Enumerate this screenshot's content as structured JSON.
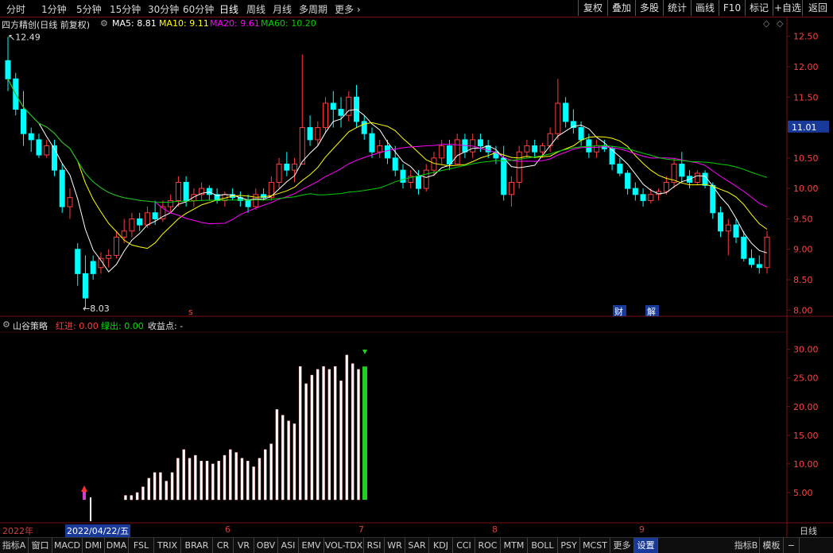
{
  "toolbar": {
    "timeframes": [
      "分时",
      "1分钟",
      "5分钟",
      "15分钟",
      "30分钟",
      "60分钟",
      "日线",
      "周线",
      "月线",
      "多周期",
      "更多"
    ],
    "active_timeframe": "日线",
    "right_buttons": [
      "复权",
      "叠加",
      "多股",
      "统计",
      "画线",
      "F10",
      "标记",
      "+自选",
      "返回"
    ]
  },
  "chart_header": {
    "stock_title": "四方精创(日线 前复权)",
    "ma5": "MA5: 8.81",
    "ma10": "MA10: 9.11",
    "ma20": "MA20: 9.61",
    "ma60": "MA60: 10.20",
    "high_label": "12.49",
    "low_label": "8.03",
    "current_price": "11.01",
    "markers": {
      "s": "s",
      "cai": "财",
      "jie": "解"
    }
  },
  "price_axis": {
    "ticks": [
      "12.50",
      "12.00",
      "11.50",
      "11.01",
      "10.50",
      "10.00",
      "9.50",
      "9.00",
      "8.50",
      "8.00"
    ]
  },
  "indicator": {
    "name": "山谷策略",
    "red_label": "红进: 0.00",
    "green_label": "绿出: 0.00",
    "profit_label": "收益点: -",
    "ticks": [
      "30.00",
      "25.00",
      "20.00",
      "15.00",
      "10.00",
      "5.00"
    ]
  },
  "date_axis": {
    "year": "2022年",
    "selected_date": "2022/04/22/五",
    "months": [
      "6",
      "7",
      "8",
      "9"
    ],
    "right_label": "日线"
  },
  "tabs": {
    "items": [
      "指标A",
      "窗口",
      "MACD",
      "DMI",
      "DMA",
      "FSL",
      "TRIX",
      "BRAR",
      "CR",
      "VR",
      "OBV",
      "ASI",
      "EMV",
      "VOL-TDX",
      "RSI",
      "WR",
      "SAR",
      "KDJ",
      "CCI",
      "ROC",
      "MTM",
      "BOLL",
      "PSY",
      "MCST",
      "更多",
      "设置"
    ],
    "right_items": [
      "指标B",
      "模板",
      "−"
    ]
  },
  "colors": {
    "up": "#ff3c3c",
    "down": "#00ffff",
    "ma5": "#ffffff",
    "ma10": "#ffff00",
    "ma20": "#ff00ff",
    "ma60": "#00d000",
    "grid": "#7a1010"
  },
  "chart_data": {
    "type": "candlestick",
    "price_range": [
      7.9,
      12.6
    ],
    "candles": [
      [
        12.1,
        12.49,
        11.6,
        11.8
      ],
      [
        11.8,
        11.9,
        11.2,
        11.3
      ],
      [
        11.3,
        11.6,
        10.7,
        10.9
      ],
      [
        10.9,
        11.0,
        10.6,
        10.8
      ],
      [
        10.8,
        10.9,
        10.5,
        10.55
      ],
      [
        10.55,
        10.8,
        10.5,
        10.7
      ],
      [
        10.7,
        10.8,
        10.2,
        10.3
      ],
      [
        10.3,
        10.4,
        9.6,
        9.7
      ],
      [
        9.7,
        10.0,
        9.5,
        9.85
      ],
      [
        9.0,
        9.1,
        8.4,
        8.6
      ],
      [
        8.6,
        8.9,
        8.03,
        8.2
      ],
      [
        8.8,
        8.9,
        8.5,
        8.6
      ],
      [
        8.7,
        8.95,
        8.6,
        8.85
      ],
      [
        8.85,
        9.0,
        8.7,
        8.9
      ],
      [
        8.9,
        9.3,
        8.85,
        9.2
      ],
      [
        9.2,
        9.5,
        9.1,
        9.3
      ],
      [
        9.3,
        9.6,
        9.2,
        9.5
      ],
      [
        9.5,
        9.6,
        9.3,
        9.4
      ],
      [
        9.4,
        9.7,
        9.35,
        9.6
      ],
      [
        9.6,
        9.8,
        9.4,
        9.5
      ],
      [
        9.5,
        9.8,
        9.45,
        9.7
      ],
      [
        9.7,
        9.9,
        9.6,
        9.8
      ],
      [
        9.8,
        10.2,
        9.7,
        10.1
      ],
      [
        10.1,
        10.2,
        9.7,
        9.8
      ],
      [
        9.8,
        10.0,
        9.7,
        9.9
      ],
      [
        9.9,
        10.1,
        9.8,
        10.0
      ],
      [
        10.0,
        10.05,
        9.8,
        9.9
      ],
      [
        9.9,
        10.0,
        9.75,
        9.8
      ],
      [
        9.8,
        9.95,
        9.7,
        9.9
      ],
      [
        9.9,
        10.0,
        9.8,
        9.85
      ],
      [
        9.85,
        9.95,
        9.7,
        9.8
      ],
      [
        9.8,
        9.9,
        9.6,
        9.7
      ],
      [
        9.7,
        10.0,
        9.65,
        9.9
      ],
      [
        9.9,
        10.0,
        9.8,
        9.85
      ],
      [
        9.85,
        10.2,
        9.8,
        10.1
      ],
      [
        10.1,
        10.5,
        10.0,
        10.4
      ],
      [
        10.4,
        10.6,
        10.2,
        10.3
      ],
      [
        10.3,
        10.5,
        10.1,
        10.4
      ],
      [
        10.4,
        12.2,
        10.6,
        11.0
      ],
      [
        11.0,
        11.2,
        10.7,
        10.8
      ],
      [
        10.8,
        11.1,
        10.7,
        11.0
      ],
      [
        11.0,
        11.5,
        10.9,
        11.4
      ],
      [
        11.4,
        11.6,
        11.0,
        11.3
      ],
      [
        11.3,
        11.5,
        11.0,
        11.2
      ],
      [
        11.2,
        11.6,
        11.1,
        11.5
      ],
      [
        11.5,
        11.7,
        11.0,
        11.1
      ],
      [
        11.1,
        11.2,
        10.8,
        10.9
      ],
      [
        10.9,
        11.0,
        10.5,
        10.6
      ],
      [
        10.6,
        10.8,
        10.5,
        10.7
      ],
      [
        10.7,
        10.8,
        10.4,
        10.5
      ],
      [
        10.5,
        10.7,
        10.2,
        10.3
      ],
      [
        10.3,
        10.4,
        10.0,
        10.1
      ],
      [
        10.1,
        10.3,
        10.0,
        10.2
      ],
      [
        10.2,
        10.3,
        9.9,
        10.0
      ],
      [
        10.0,
        10.4,
        9.95,
        10.3
      ],
      [
        10.3,
        10.6,
        10.2,
        10.5
      ],
      [
        10.5,
        10.8,
        10.4,
        10.7
      ],
      [
        10.7,
        10.8,
        10.3,
        10.4
      ],
      [
        10.4,
        10.9,
        10.4,
        10.8
      ],
      [
        10.8,
        10.9,
        10.5,
        10.6
      ],
      [
        10.6,
        10.9,
        10.5,
        10.8
      ],
      [
        10.8,
        10.9,
        10.6,
        10.7
      ],
      [
        10.7,
        10.8,
        10.5,
        10.6
      ],
      [
        10.6,
        10.7,
        10.4,
        10.5
      ],
      [
        10.5,
        10.7,
        9.8,
        9.9
      ],
      [
        9.9,
        10.2,
        9.7,
        10.1
      ],
      [
        10.1,
        10.7,
        10.0,
        10.6
      ],
      [
        10.6,
        10.8,
        10.5,
        10.7
      ],
      [
        10.7,
        10.8,
        10.5,
        10.6
      ],
      [
        10.6,
        10.75,
        10.5,
        10.7
      ],
      [
        10.7,
        11.0,
        10.6,
        10.9
      ],
      [
        10.9,
        11.8,
        10.8,
        11.4
      ],
      [
        11.4,
        11.5,
        11.0,
        11.1
      ],
      [
        11.1,
        11.3,
        10.9,
        11.0
      ],
      [
        11.0,
        11.1,
        10.7,
        10.8
      ],
      [
        10.8,
        10.9,
        10.5,
        10.6
      ],
      [
        10.6,
        10.8,
        10.5,
        10.7
      ],
      [
        10.7,
        10.8,
        10.6,
        10.65
      ],
      [
        10.65,
        10.7,
        10.3,
        10.4
      ],
      [
        10.4,
        10.5,
        10.2,
        10.25
      ],
      [
        10.25,
        10.3,
        9.9,
        10.0
      ],
      [
        10.0,
        10.1,
        9.8,
        9.9
      ],
      [
        9.9,
        10.0,
        9.7,
        9.8
      ],
      [
        9.8,
        10.0,
        9.75,
        9.9
      ],
      [
        9.9,
        10.0,
        9.8,
        9.95
      ],
      [
        9.95,
        10.2,
        9.9,
        10.1
      ],
      [
        10.1,
        10.5,
        10.0,
        10.4
      ],
      [
        10.4,
        10.6,
        10.1,
        10.2
      ],
      [
        10.2,
        10.3,
        10.0,
        10.1
      ],
      [
        10.1,
        10.3,
        10.05,
        10.25
      ],
      [
        10.25,
        10.3,
        10.0,
        10.05
      ],
      [
        10.05,
        10.1,
        9.5,
        9.6
      ],
      [
        9.6,
        9.7,
        9.2,
        9.3
      ],
      [
        9.3,
        9.5,
        8.9,
        9.4
      ],
      [
        9.4,
        9.5,
        9.1,
        9.2
      ],
      [
        9.2,
        9.3,
        8.8,
        8.85
      ],
      [
        8.85,
        9.0,
        8.7,
        8.75
      ],
      [
        8.75,
        8.9,
        8.6,
        8.7
      ],
      [
        8.7,
        9.3,
        8.6,
        9.2
      ]
    ],
    "indicator_series": {
      "name": "山谷策略",
      "values": [
        0.4,
        0.4,
        1.2,
        0.5,
        1.0,
        1.0,
        4.5,
        4.5,
        5.0,
        6.0,
        7.5,
        8.5,
        8.5,
        7.0,
        8.5,
        11.0,
        12.5,
        11.0,
        11.5,
        10.5,
        10.5,
        10.0,
        10.5,
        11.5,
        12.5,
        12.0,
        11.0,
        10.5,
        9.5,
        11.0,
        12.5,
        13.5,
        19.5,
        18.5,
        17.5,
        17.0,
        27.0,
        24.0,
        25.5,
        26.5,
        27.0,
        26.5,
        27.0,
        24.5,
        29.0,
        27.5,
        26.5
      ]
    }
  }
}
